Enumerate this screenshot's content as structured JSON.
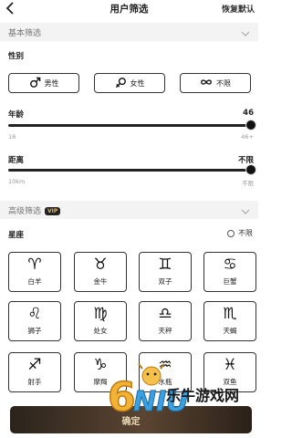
{
  "header": {
    "title": "用户筛选",
    "reset_label": "恢复默认"
  },
  "basic_section": {
    "label": "基本筛选"
  },
  "gender": {
    "label": "性别",
    "options": [
      {
        "label": "男性",
        "icon": "male-icon"
      },
      {
        "label": "女性",
        "icon": "female-icon"
      },
      {
        "label": "不限",
        "icon": "infinity-icon"
      }
    ]
  },
  "age": {
    "label": "年龄",
    "value": "46",
    "min_label": "18",
    "max_label": "46+",
    "level": 1.0
  },
  "distance": {
    "label": "距离",
    "value": "不限",
    "min_label": "10km",
    "max_label": "不限",
    "level": 1.0
  },
  "advanced_section": {
    "label": "高级筛选",
    "badge": "VIP"
  },
  "zodiac": {
    "label": "星座",
    "unlimited_label": "不限",
    "signs": [
      {
        "symbol": "♈",
        "label": "白羊"
      },
      {
        "symbol": "♉",
        "label": "金牛"
      },
      {
        "symbol": "♊",
        "label": "双子"
      },
      {
        "symbol": "♋",
        "label": "巨蟹"
      },
      {
        "symbol": "♌",
        "label": "狮子"
      },
      {
        "symbol": "♍",
        "label": "处女"
      },
      {
        "symbol": "♎",
        "label": "天秤"
      },
      {
        "symbol": "♏",
        "label": "天蝎"
      },
      {
        "symbol": "♐",
        "label": "射手"
      },
      {
        "symbol": "♑",
        "label": "摩羯"
      },
      {
        "symbol": "♒",
        "label": "水瓶"
      },
      {
        "symbol": "♓",
        "label": "双鱼"
      }
    ]
  },
  "confirm_label": "确定",
  "watermark": {
    "text": "乐牛游戏网",
    "logo_text": "6NIU"
  },
  "colors": {
    "accent_dark": "#2b231b",
    "accent_gold": "#e9d7b6",
    "vip_gold": "#e0b964",
    "section_bg": "#f3f3f3"
  }
}
